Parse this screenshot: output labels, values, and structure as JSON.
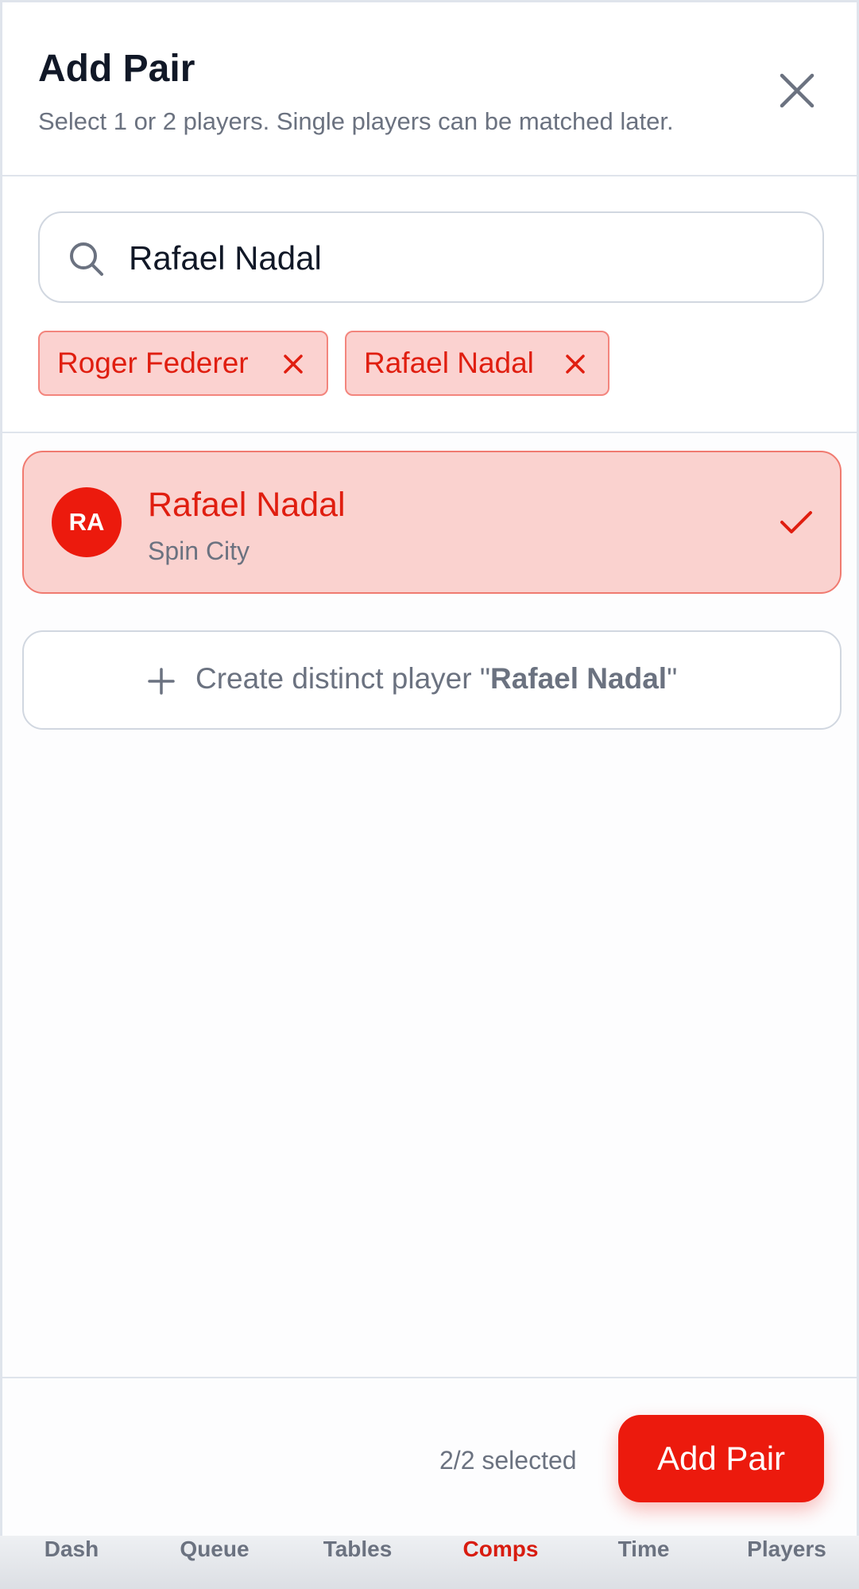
{
  "header": {
    "title": "Add Pair",
    "subtitle": "Select 1 or 2 players. Single players can be matched later."
  },
  "search": {
    "value": "Rafael Nadal"
  },
  "chips": [
    {
      "label": "Roger Federer"
    },
    {
      "label": "Rafael Nadal"
    }
  ],
  "results": [
    {
      "initials": "RA",
      "name": "Rafael Nadal",
      "team": "Spin City",
      "selected": true
    }
  ],
  "create": {
    "prefix": "Create distinct player \"",
    "name": "Rafael Nadal",
    "suffix": "\""
  },
  "footer": {
    "selected_text": "2/2 selected",
    "add_label": "Add Pair"
  },
  "tabs": [
    {
      "label": "Dash"
    },
    {
      "label": "Queue"
    },
    {
      "label": "Tables"
    },
    {
      "label": "Comps",
      "active": true
    },
    {
      "label": "Time"
    },
    {
      "label": "Players"
    }
  ],
  "colors": {
    "accent": "#ec1a0d",
    "selected_bg": "#fad2cf",
    "text_muted": "#6b7280"
  }
}
